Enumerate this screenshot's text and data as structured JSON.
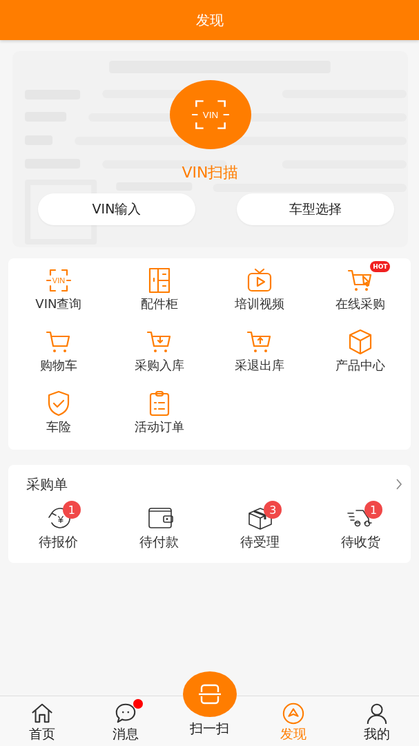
{
  "header": {
    "title": "发现"
  },
  "scan": {
    "icon_text": "VIN",
    "label": "VIN扫描",
    "buttons": [
      "VIN输入",
      "车型选择"
    ]
  },
  "tools": [
    {
      "kind": "vin",
      "icon_text": "VIN",
      "label": "VIN查询"
    },
    {
      "kind": "cabinet",
      "label": "配件柜"
    },
    {
      "kind": "video",
      "label": "培训视频"
    },
    {
      "kind": "cart-click",
      "label": "在线采购",
      "badge": "HOT"
    },
    {
      "kind": "cart",
      "label": "购物车"
    },
    {
      "kind": "cart-in",
      "label": "采购入库"
    },
    {
      "kind": "cart-out",
      "label": "采退出库"
    },
    {
      "kind": "cube",
      "label": "产品中心"
    },
    {
      "kind": "shield",
      "label": "车险"
    },
    {
      "kind": "clipboard",
      "label": "活动订单"
    }
  ],
  "orders": {
    "title": "采购单",
    "items": [
      {
        "kind": "yen",
        "icon_text": "¥",
        "label": "待报价",
        "count": "1"
      },
      {
        "kind": "wallet",
        "label": "待付款"
      },
      {
        "kind": "parcel",
        "label": "待受理",
        "count": "3"
      },
      {
        "kind": "truck",
        "label": "待收货",
        "count": "1"
      }
    ]
  },
  "tabbar": [
    {
      "kind": "home",
      "label": "首页",
      "selected": false,
      "dot": false
    },
    {
      "kind": "chat",
      "label": "消息",
      "selected": false,
      "dot": true
    },
    {
      "kind": "scan",
      "label": "扫一扫",
      "selected": false,
      "dot": false
    },
    {
      "kind": "compass",
      "label": "发现",
      "selected": true,
      "dot": false
    },
    {
      "kind": "user",
      "label": "我的",
      "selected": false,
      "dot": false
    }
  ]
}
